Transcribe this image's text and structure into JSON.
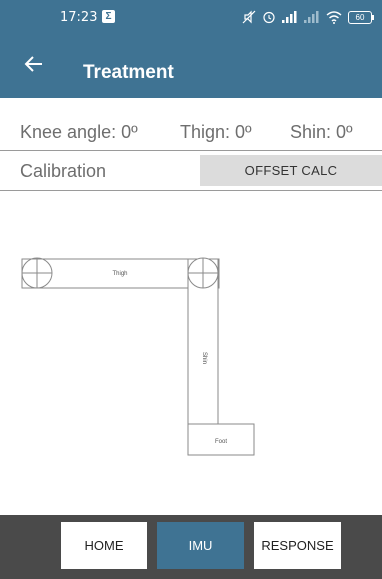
{
  "status_bar": {
    "time": "17:23",
    "sigma_badge": "Σ",
    "battery": "60",
    "icons": [
      "mute-icon",
      "alarm-icon",
      "signal-icon",
      "signal-weak-icon",
      "wifi-icon",
      "battery-icon"
    ]
  },
  "app_bar": {
    "title": "Treatment",
    "back_icon": "back-arrow-icon"
  },
  "metrics": {
    "knee": "Knee angle: 0º",
    "thigh": "Thign: 0º",
    "shin": "Shin: 0º"
  },
  "calibration": {
    "label": "Calibration",
    "button": "OFFSET CALC"
  },
  "diagram": {
    "thigh_label": "Thigh",
    "shin_label": "Shin",
    "foot_label": "Foot",
    "knee_angle_deg": 0,
    "thigh_angle_deg": 0,
    "shin_angle_deg": 0
  },
  "bottom_nav": {
    "home": "HOME",
    "imu": "IMU",
    "response": "RESPONSE",
    "active": "IMU"
  },
  "colors": {
    "primary": "#3f7393",
    "nav_background": "#4a4a4a",
    "button_grey": "#dcdcdc",
    "text_grey": "#6e6e6e"
  }
}
